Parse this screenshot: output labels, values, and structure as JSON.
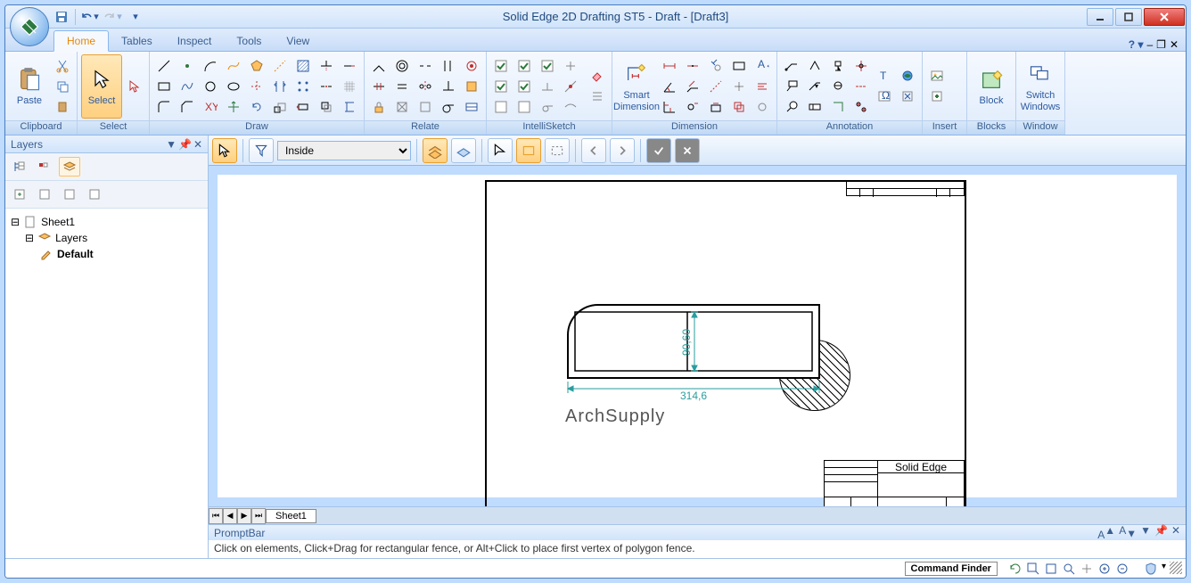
{
  "window": {
    "title": "Solid Edge 2D Drafting ST5 - Draft - [Draft3]"
  },
  "tabs": {
    "items": [
      "Home",
      "Tables",
      "Inspect",
      "Tools",
      "View"
    ],
    "active": "Home"
  },
  "ribbon": {
    "groups": {
      "clipboard": {
        "label": "Clipboard",
        "paste": "Paste"
      },
      "select": {
        "label": "Select",
        "select": "Select"
      },
      "draw": {
        "label": "Draw"
      },
      "relate": {
        "label": "Relate"
      },
      "intelli": {
        "label": "IntelliSketch"
      },
      "dimension": {
        "label": "Dimension",
        "smart": "Smart\nDimension"
      },
      "annotation": {
        "label": "Annotation"
      },
      "insert": {
        "label": "Insert"
      },
      "blocks": {
        "label": "Blocks",
        "block": "Block"
      },
      "window_g": {
        "label": "Window",
        "switch_windows": "Switch\nWindows"
      }
    }
  },
  "sidebar": {
    "title": "Layers",
    "tree": {
      "sheet": "Sheet1",
      "layers": "Layers",
      "default": "Default"
    }
  },
  "options_bar": {
    "mode_select": "Inside"
  },
  "sheet_tabs": {
    "active": "Sheet1"
  },
  "drawing": {
    "dim_width": "314,6",
    "dim_height": "90,60",
    "watermark": "ArchSupply",
    "titleblock_app": "Solid Edge"
  },
  "prompt": {
    "label": "PromptBar",
    "text": "Click on elements, Click+Drag for rectangular fence, or Alt+Click to place first vertex of polygon fence."
  },
  "statusbar": {
    "command_finder": "Command Finder"
  }
}
